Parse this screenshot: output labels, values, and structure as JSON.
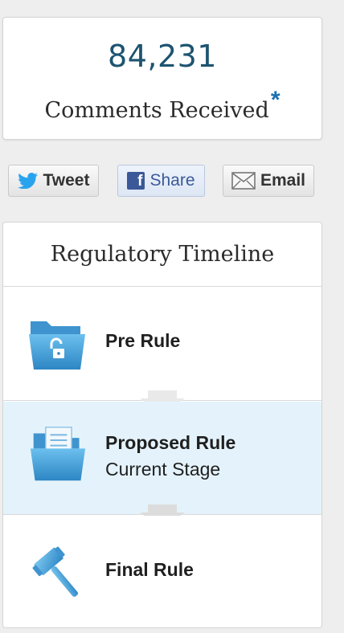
{
  "comments": {
    "count": "84,231",
    "label": "Comments Received",
    "footnote_mark": "*"
  },
  "share": {
    "tweet_label": "Tweet",
    "share_label": "Share",
    "email_label": "Email"
  },
  "timeline": {
    "title": "Regulatory Timeline",
    "stages": [
      {
        "name": "Pre Rule",
        "status": "",
        "icon": "open-folder-lock-icon"
      },
      {
        "name": "Proposed Rule",
        "status": "Current Stage",
        "icon": "folder-documents-icon"
      },
      {
        "name": "Final Rule",
        "status": "",
        "icon": "gavel-icon"
      }
    ]
  },
  "colors": {
    "count_blue": "#1d5470",
    "accent_blue": "#1a6fb0",
    "current_stage_bg": "#e4f3fb",
    "icon_blue": "#3e9ad6"
  }
}
